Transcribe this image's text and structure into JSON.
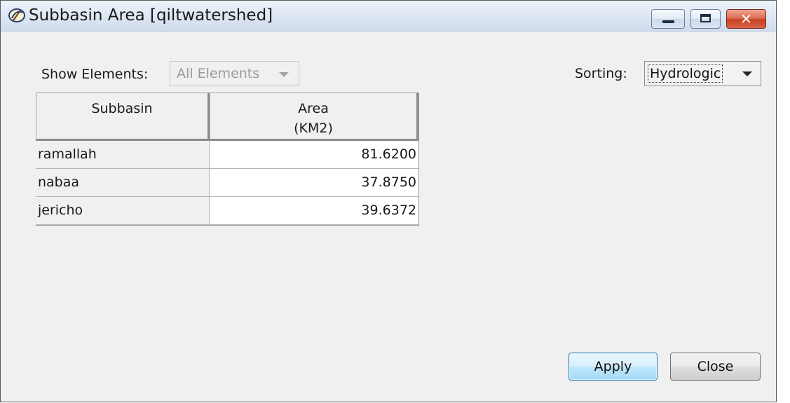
{
  "window": {
    "title": "Subbasin Area [qiltwatershed]",
    "icon": "hec-hms-app-icon",
    "controls": {
      "minimize": "minimize-icon",
      "maximize": "maximize-icon",
      "close": "✕"
    }
  },
  "filters": {
    "show_elements_label": "Show Elements:",
    "show_elements_value": "All Elements",
    "sorting_label": "Sorting:",
    "sorting_value": "Hydrologic"
  },
  "table": {
    "columns": [
      {
        "label": "Subbasin",
        "unit": ""
      },
      {
        "label": "Area",
        "unit": "(KM2)"
      }
    ],
    "rows": [
      {
        "subbasin": "ramallah",
        "area": "81.6200"
      },
      {
        "subbasin": "nabaa",
        "area": "37.8750"
      },
      {
        "subbasin": "jericho",
        "area": "39.6372"
      }
    ]
  },
  "buttons": {
    "apply": "Apply",
    "close": "Close"
  },
  "colors": {
    "window_bg": "#f0f0f0",
    "titlebar": "#dfe8f4",
    "close_button": "#c7401f",
    "apply_button": "#bee6fd"
  }
}
